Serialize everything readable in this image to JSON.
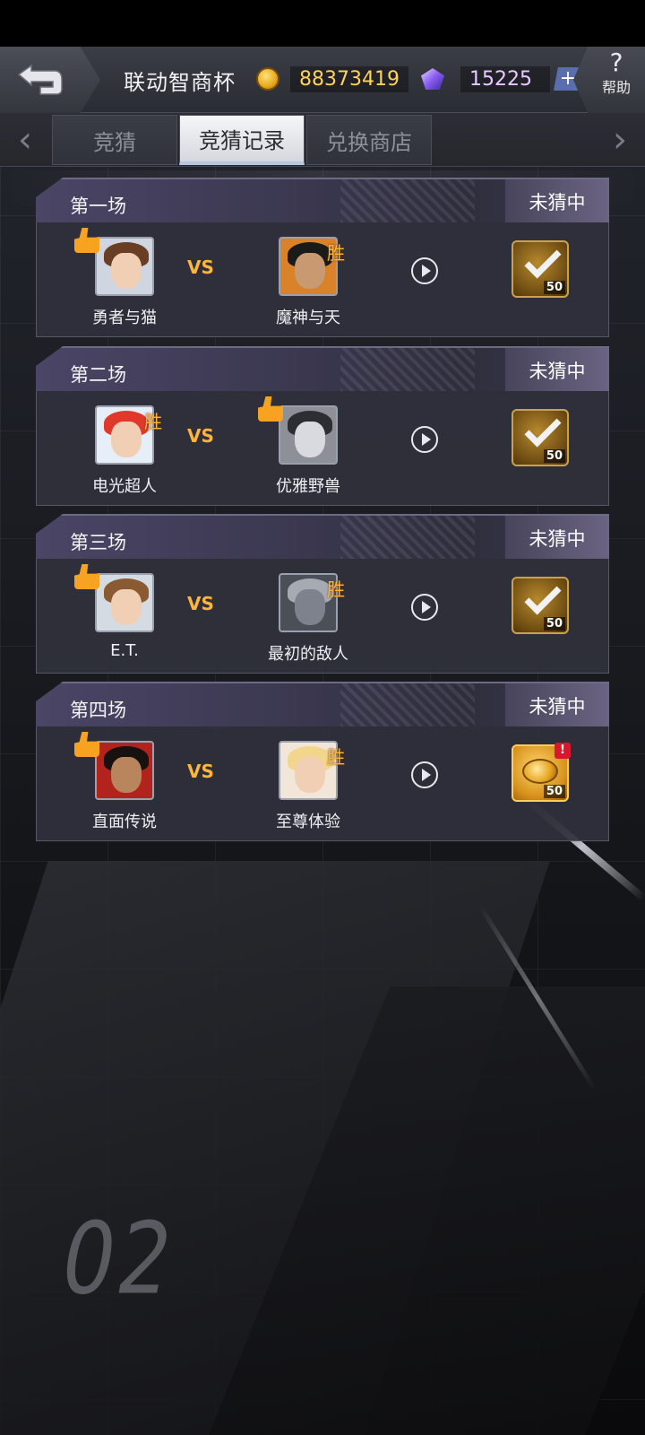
{
  "header": {
    "title": "联动智商杯",
    "coins": "88373419",
    "gems": "15225",
    "plus_label": "+",
    "help_symbol": "?",
    "help_label": "帮助"
  },
  "tabs": {
    "left_arrow": "‹",
    "right_arrow": "›",
    "items": [
      "竞猜",
      "竞猜记录",
      "兑换商店"
    ],
    "selected": "竞猜记录"
  },
  "vs_label": "VS",
  "win_label": "胜",
  "matches": [
    {
      "title": "第一场",
      "result": "未猜中",
      "left_name": "勇者与猫",
      "right_name": "魔神与天",
      "bet_on": "left",
      "winner": "right",
      "reward_count": "50",
      "reward_state": "claimed"
    },
    {
      "title": "第二场",
      "result": "未猜中",
      "left_name": "电光超人",
      "right_name": "优雅野兽",
      "bet_on": "right",
      "winner": "left",
      "reward_count": "50",
      "reward_state": "claimed"
    },
    {
      "title": "第三场",
      "result": "未猜中",
      "left_name": "E.T.",
      "right_name": "最初的敌人",
      "bet_on": "left",
      "winner": "right",
      "reward_count": "50",
      "reward_state": "claimed"
    },
    {
      "title": "第四场",
      "result": "未猜中",
      "left_name": "直面传说",
      "right_name": "至尊体验",
      "bet_on": "left",
      "winner": "right",
      "reward_count": "50",
      "reward_state": "available",
      "alert_symbol": "!"
    }
  ],
  "background": {
    "watermark": "02"
  },
  "icons": [
    "back-arrow-icon",
    "coin-icon",
    "gem-icon",
    "thumbs-up-icon",
    "play-icon",
    "check-icon",
    "coins-icon"
  ],
  "colors": {
    "accent_gold": "#ffb43c",
    "coin_text": "#ffd25a",
    "gem_text": "#e8c8ff",
    "selected_tab": "#f5f6f8"
  }
}
